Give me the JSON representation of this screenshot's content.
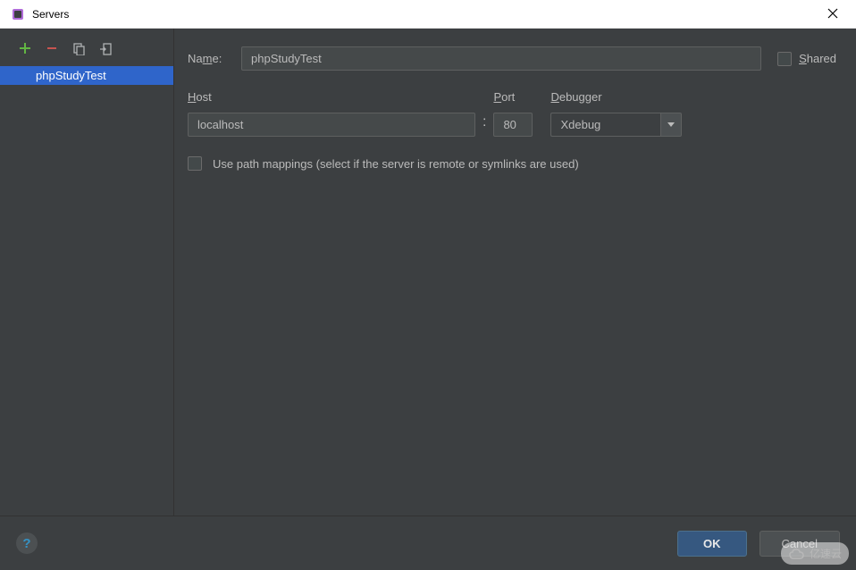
{
  "window": {
    "title": "Servers"
  },
  "toolbar": {
    "add_icon": "plus-icon",
    "remove_icon": "minus-icon",
    "copy_icon": "copy-icon",
    "import_icon": "import-icon"
  },
  "server_list": {
    "items": [
      {
        "name": "phpStudyTest",
        "selected": true
      }
    ]
  },
  "form": {
    "name_label": "Name:",
    "name_value": "phpStudyTest",
    "shared_label": "Shared",
    "host_label": "Host",
    "host_value": "localhost",
    "port_label": "Port",
    "port_value": "80",
    "debugger_label": "Debugger",
    "debugger_value": "Xdebug",
    "mappings_label": "Use path mappings (select if the server is remote or symlinks are used)"
  },
  "footer": {
    "ok_label": "OK",
    "cancel_label": "Cancel"
  },
  "watermark": {
    "text": "亿速云"
  }
}
